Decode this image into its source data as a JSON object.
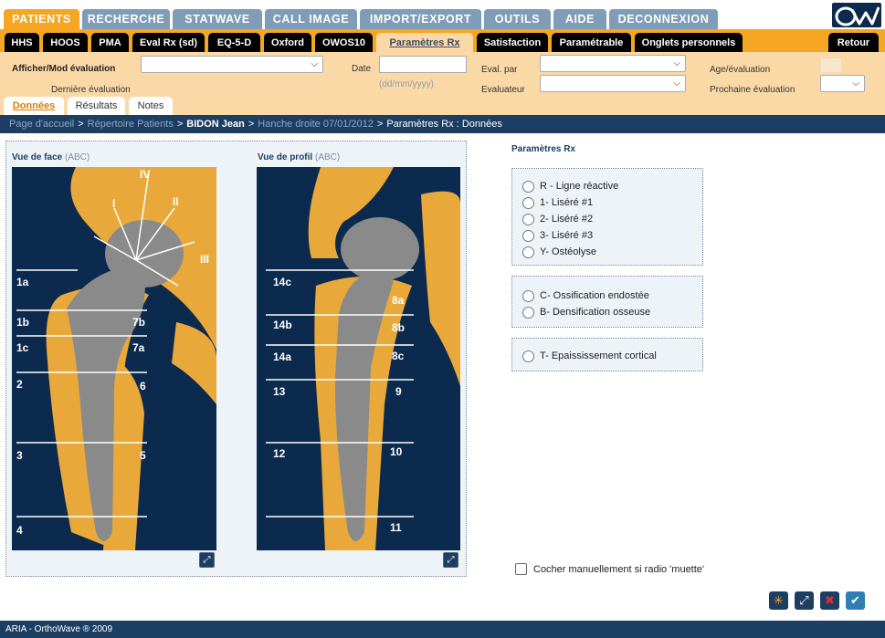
{
  "main_tabs": [
    "PATIENTS",
    "RECHERCHE",
    "STATWAVE",
    "CALL IMAGE",
    "IMPORT/EXPORT",
    "OUTILS",
    "AIDE",
    "DECONNEXION"
  ],
  "sub_tabs": [
    "HHS",
    "HOOS",
    "PMA",
    "Eval Rx (sd)",
    "EQ-5-D",
    "Oxford",
    "OWOS10",
    "Paramètres Rx",
    "Satisfaction",
    "Paramétrable",
    "Onglets personnels"
  ],
  "retour": "Retour",
  "form": {
    "afficher": "Afficher/Mod évaluation",
    "derniere": "Dernière évaluation",
    "date": "Date",
    "date_format": "(dd/mm/yyyy)",
    "eval_par": "Eval. par",
    "evaluateur": "Evaluateur",
    "age": "Age/évaluation",
    "prochaine": "Prochaine évaluation"
  },
  "page_tabs": [
    "Données",
    "Résultats",
    "Notes"
  ],
  "breadcrumb": {
    "home": "Page d'accueil",
    "repertoire": "Répertoire Patients",
    "patient": "BIDON Jean",
    "episode": "Hanche droite 07/01/2012",
    "current": "Paramètres Rx : Données",
    "sep": ">"
  },
  "views": {
    "face_title": "Vue de face",
    "face_sub": "(ABC)",
    "profil_title": "Vue de profil",
    "profil_sub": "(ABC)"
  },
  "zones_face": [
    "IV",
    "I",
    "II",
    "III",
    "1a",
    "1b",
    "1c",
    "2",
    "3",
    "4",
    "7b",
    "7a",
    "6",
    "5"
  ],
  "zones_profil": [
    "14c",
    "14b",
    "14a",
    "13",
    "12",
    "8a",
    "8b",
    "8c",
    "9",
    "10",
    "11"
  ],
  "params": {
    "title": "Paramètres Rx",
    "group1": [
      "R - Ligne réactive",
      "1- Liséré #1",
      "2- Liséré #2",
      "3- Liséré #3",
      "Y- Ostéolyse"
    ],
    "group2": [
      "C- Ossification endostée",
      "B- Densification osseuse"
    ],
    "group3": [
      "T- Epaississement cortical"
    ]
  },
  "checkbox_label": "Cocher manuellement si radio 'muette'",
  "footer": "ARIA - OrthoWave ® 2009",
  "colors": {
    "accent": "#f5a623",
    "navy": "#1d3e63",
    "bone": "#e8a93a",
    "implant": "#8a8a8a",
    "xray_bg": "#0c2a4e"
  }
}
